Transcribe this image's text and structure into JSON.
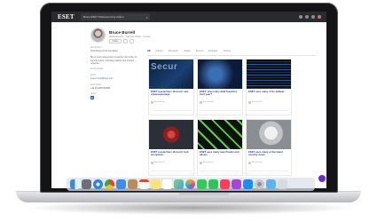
{
  "browser": {
    "logo": "ESET",
    "tab_title": "Bruce ESET Welivesecurity Author",
    "tab_close": "×"
  },
  "profile": {
    "name": "Bruce Burrell",
    "subtitle": "Welivesecurity · Security Writer · 5 posts",
    "follow_label": "Follow",
    "more_label": "···"
  },
  "sidebar": {
    "about_label": "About Bruce",
    "intro": "Find things on this site about:",
    "bio": "Bruce is an independent researcher and writer on security topics, including malware and incident response.",
    "stats_label": "Social profiles",
    "email_label": "Email",
    "email_value": "bruce.burrell@eset.com",
    "phone_label": "Work phone",
    "phone_value": "+44 (0) 1865 000000",
    "social_label": "Social",
    "social_icon": "in"
  },
  "content_tabs": [
    "All",
    "Articles",
    "Research",
    "Videos",
    "Events",
    "Podcasts",
    "Archive"
  ],
  "cards": [
    {
      "image": "security-image",
      "image_word": "Secur",
      "title": "ESET researchers discover new cyberespionage",
      "author": "Bruce Burrell"
    },
    {
      "image": "blue-tech-image",
      "image_word": "",
      "title": "ESET: How many data breaches next year?",
      "author": "Bruce Burrell"
    },
    {
      "image": "code-image",
      "image_word": "",
      "title": "ESET sees many of its dataset",
      "author": "Bruce Burrell"
    },
    {
      "image": "lock-image",
      "image_word": "",
      "title": "ESET researchers discover lock encryption",
      "author": "Bruce Burrell"
    },
    {
      "image": "lime-image",
      "image_word": "",
      "title": "ESET sees many new threats and advice",
      "author": "Bruce Burrell"
    },
    {
      "image": "gray-image",
      "image_word": "",
      "title": "ESET sees many of the latest security news",
      "author": "Bruce Burrell"
    }
  ],
  "dock_icons": [
    "finder-icon",
    "launchpad-icon",
    "safari-icon",
    "chrome-icon",
    "mail-icon",
    "contacts-icon",
    "calendar-icon",
    "notes-icon",
    "reminders-icon",
    "maps-icon",
    "photos-icon",
    "messages-icon",
    "facetime-icon",
    "music-icon",
    "podcasts-icon",
    "appstore-icon",
    "settings-icon",
    "folder-icon",
    "trash-icon"
  ],
  "colors": {
    "accent": "#1e3a8a",
    "chat_bubble": "#6a2bdc"
  }
}
